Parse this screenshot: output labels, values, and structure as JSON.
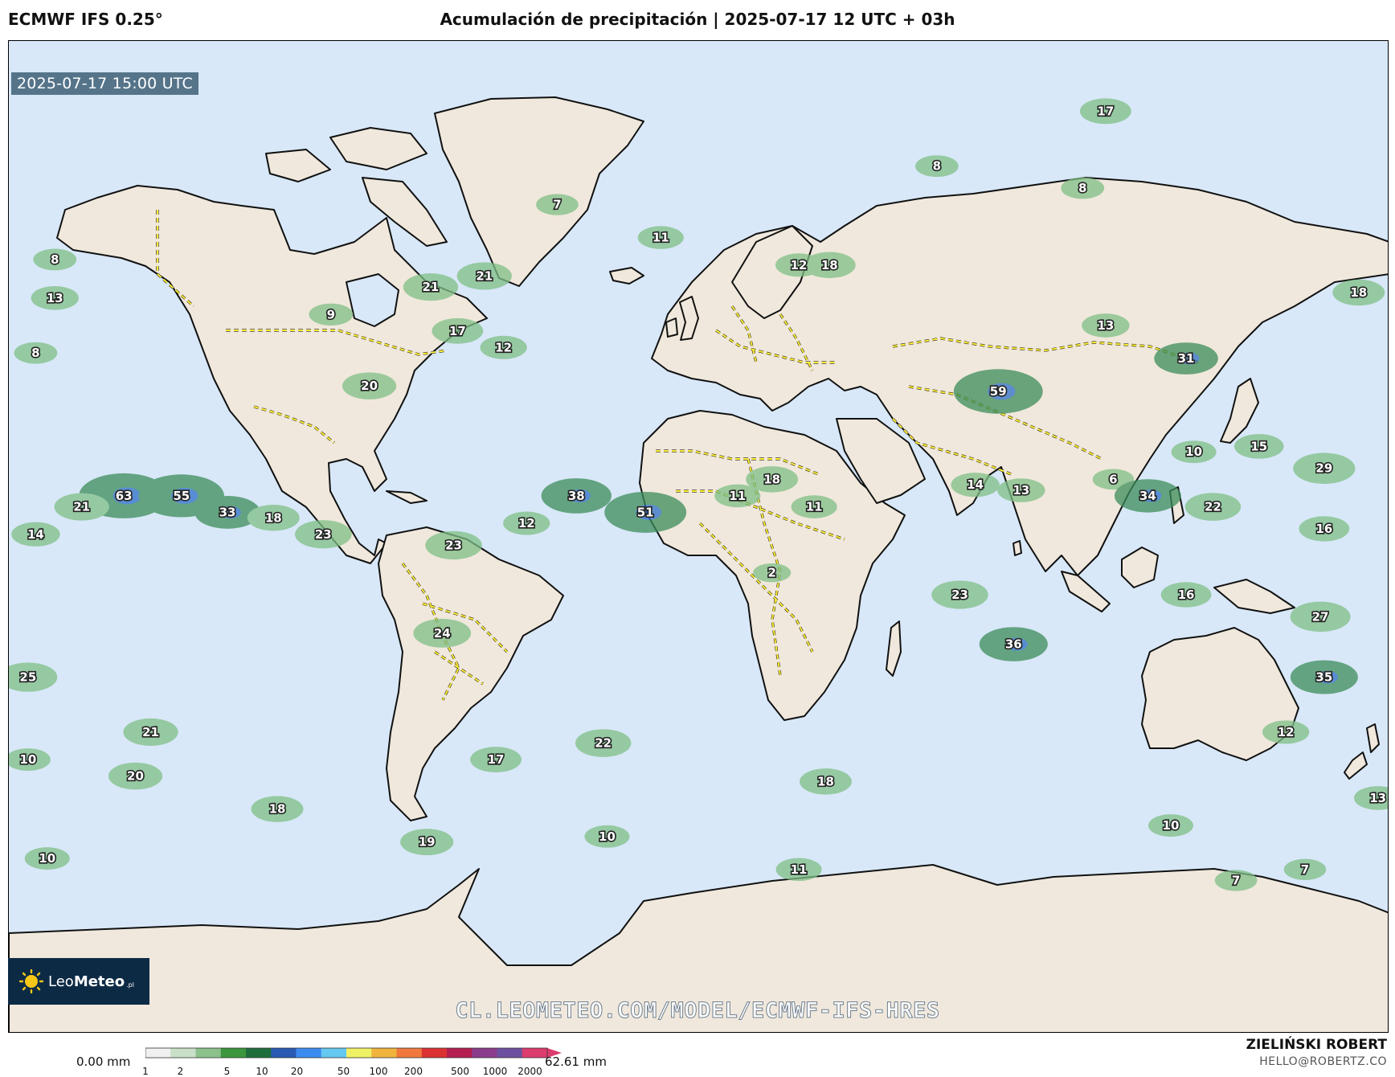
{
  "header": {
    "model": "ECMWF IFS 0.25°",
    "title": "Acumulación de precipitación | 2025-07-17 12 UTC + 03h"
  },
  "map": {
    "timestamp": "2025-07-17 15:00 UTC",
    "ocean_color": "#d8e8f8",
    "land_color": "#f0e8dc",
    "border_color": "#ffee33",
    "precip_labels": [
      {
        "v": "17",
        "lon": 106,
        "lat": 80
      },
      {
        "v": "8",
        "lon": 62,
        "lat": 70
      },
      {
        "v": "8",
        "lon": 100,
        "lat": 66
      },
      {
        "v": "18",
        "lon": 172,
        "lat": 47
      },
      {
        "v": "7",
        "lon": -37,
        "lat": 63
      },
      {
        "v": "11",
        "lon": -10,
        "lat": 57
      },
      {
        "v": "8",
        "lon": -168,
        "lat": 53
      },
      {
        "v": "13",
        "lon": -168,
        "lat": 46
      },
      {
        "v": "8",
        "lon": -173,
        "lat": 36
      },
      {
        "v": "21",
        "lon": -70,
        "lat": 48
      },
      {
        "v": "21",
        "lon": -56,
        "lat": 50
      },
      {
        "v": "9",
        "lon": -96,
        "lat": 43
      },
      {
        "v": "17",
        "lon": -63,
        "lat": 40
      },
      {
        "v": "12",
        "lon": -51,
        "lat": 37
      },
      {
        "v": "20",
        "lon": -86,
        "lat": 30
      },
      {
        "v": "12",
        "lon": 26,
        "lat": 52
      },
      {
        "v": "18",
        "lon": 34,
        "lat": 52
      },
      {
        "v": "13",
        "lon": 106,
        "lat": 41
      },
      {
        "v": "31",
        "lon": 127,
        "lat": 35
      },
      {
        "v": "59",
        "lon": 78,
        "lat": 29
      },
      {
        "v": "10",
        "lon": 129,
        "lat": 18
      },
      {
        "v": "15",
        "lon": 146,
        "lat": 19
      },
      {
        "v": "29",
        "lon": 163,
        "lat": 15
      },
      {
        "v": "6",
        "lon": 108,
        "lat": 13
      },
      {
        "v": "14",
        "lon": 72,
        "lat": 12
      },
      {
        "v": "13",
        "lon": 84,
        "lat": 11
      },
      {
        "v": "34",
        "lon": 117,
        "lat": 10
      },
      {
        "v": "22",
        "lon": 134,
        "lat": 8
      },
      {
        "v": "16",
        "lon": 163,
        "lat": 4
      },
      {
        "v": "63",
        "lon": -150,
        "lat": 10
      },
      {
        "v": "55",
        "lon": -135,
        "lat": 10
      },
      {
        "v": "21",
        "lon": -161,
        "lat": 8
      },
      {
        "v": "33",
        "lon": -123,
        "lat": 7
      },
      {
        "v": "18",
        "lon": -111,
        "lat": 6
      },
      {
        "v": "14",
        "lon": -173,
        "lat": 3
      },
      {
        "v": "23",
        "lon": -98,
        "lat": 3
      },
      {
        "v": "12",
        "lon": -45,
        "lat": 5
      },
      {
        "v": "38",
        "lon": -32,
        "lat": 10
      },
      {
        "v": "51",
        "lon": -14,
        "lat": 7
      },
      {
        "v": "11",
        "lon": 10,
        "lat": 10
      },
      {
        "v": "18",
        "lon": 19,
        "lat": 13
      },
      {
        "v": "11",
        "lon": 30,
        "lat": 8
      },
      {
        "v": "2",
        "lon": 19,
        "lat": -4
      },
      {
        "v": "23",
        "lon": -64,
        "lat": 1
      },
      {
        "v": "23",
        "lon": 68,
        "lat": -8
      },
      {
        "v": "16",
        "lon": 127,
        "lat": -8
      },
      {
        "v": "27",
        "lon": 162,
        "lat": -12
      },
      {
        "v": "36",
        "lon": 82,
        "lat": -17
      },
      {
        "v": "24",
        "lon": -67,
        "lat": -15
      },
      {
        "v": "25",
        "lon": -175,
        "lat": -23
      },
      {
        "v": "35",
        "lon": 163,
        "lat": -23
      },
      {
        "v": "21",
        "lon": -143,
        "lat": -33
      },
      {
        "v": "12",
        "lon": 153,
        "lat": -33
      },
      {
        "v": "10",
        "lon": -175,
        "lat": -38
      },
      {
        "v": "20",
        "lon": -147,
        "lat": -41
      },
      {
        "v": "17",
        "lon": -53,
        "lat": -38
      },
      {
        "v": "22",
        "lon": -25,
        "lat": -35
      },
      {
        "v": "13",
        "lon": 177,
        "lat": -45
      },
      {
        "v": "18",
        "lon": -110,
        "lat": -47
      },
      {
        "v": "18",
        "lon": 33,
        "lat": -42
      },
      {
        "v": "10",
        "lon": -24,
        "lat": -52
      },
      {
        "v": "10",
        "lon": 123,
        "lat": -50
      },
      {
        "v": "19",
        "lon": -71,
        "lat": -53
      },
      {
        "v": "10",
        "lon": -170,
        "lat": -56
      },
      {
        "v": "11",
        "lon": 26,
        "lat": -58
      },
      {
        "v": "7",
        "lon": 140,
        "lat": -60
      },
      {
        "v": "7",
        "lon": 158,
        "lat": -58
      }
    ]
  },
  "logo": {
    "brand_light": "Leo",
    "brand_bold": "Meteo",
    "suffix": ".pl"
  },
  "watermark_url": "CL.LEOMETEO.COM/MODEL/ECMWF-IFS-HRES",
  "colorbar": {
    "min_label": "0.00 mm",
    "max_label": "62.61 mm",
    "ticks": [
      {
        "label": "1",
        "pos": 0.0
      },
      {
        "label": "2",
        "pos": 0.087
      },
      {
        "label": "5",
        "pos": 0.203
      },
      {
        "label": "10",
        "pos": 0.29
      },
      {
        "label": "20",
        "pos": 0.377
      },
      {
        "label": "50",
        "pos": 0.493
      },
      {
        "label": "100",
        "pos": 0.58
      },
      {
        "label": "200",
        "pos": 0.667
      },
      {
        "label": "500",
        "pos": 0.783
      },
      {
        "label": "1000",
        "pos": 0.87
      },
      {
        "label": "2000",
        "pos": 0.957
      }
    ],
    "colors": [
      "#f0f0f0",
      "#c8e0c8",
      "#8cc08c",
      "#3c963c",
      "#1e6e3c",
      "#285ab4",
      "#3c8cf0",
      "#64c8f0",
      "#f0f064",
      "#f0b43c",
      "#f0783c",
      "#dc3232",
      "#b41e50",
      "#8c3c8c",
      "#6e50a0",
      "#dc3c6e"
    ]
  },
  "credits": {
    "author": "ZIELIŃSKI ROBERT",
    "email": "HELLO@ROBERTZ.CO"
  }
}
